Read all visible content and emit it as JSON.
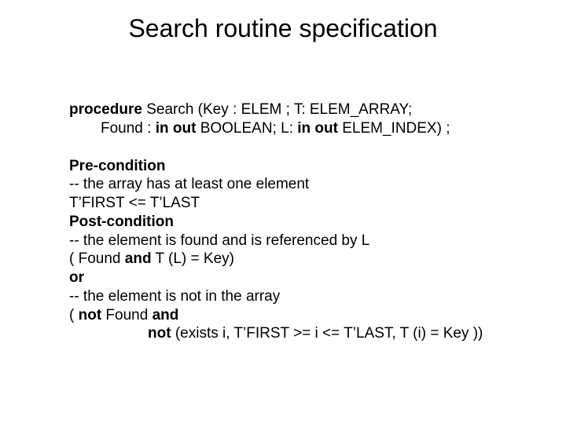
{
  "title": "Search routine specification",
  "proc": {
    "kw_procedure": "procedure",
    "sig_line1_rest": " Search (Key : ELEM ; T: ELEM_ARRAY;",
    "sig_line2_a": "Found : ",
    "kw_inout1": "in out",
    "sig_line2_b": " BOOLEAN; L: ",
    "kw_inout2": "in out",
    "sig_line2_c": " ELEM_INDEX) ;"
  },
  "spec": {
    "pre_label": "Pre-condition",
    "pre_comment": "-- the array has at least one element",
    "pre_expr": "T’FIRST <= T’LAST",
    "post_label": "Post-condition",
    "post_comment1": "-- the element is found and is referenced by L",
    "post_expr1_a": "( Found ",
    "kw_and1": "and",
    "post_expr1_b": " T (L) = Key)",
    "kw_or": "or",
    "post_comment2": "-- the element is not in the array",
    "post_expr2_a": "( ",
    "kw_not1": "not",
    "post_expr2_b": " Found ",
    "kw_and2": "and",
    "kw_not2": "not",
    "post_expr2_c": " (exists i, T’FIRST >= i <= T’LAST, T (i) = Key ))"
  }
}
